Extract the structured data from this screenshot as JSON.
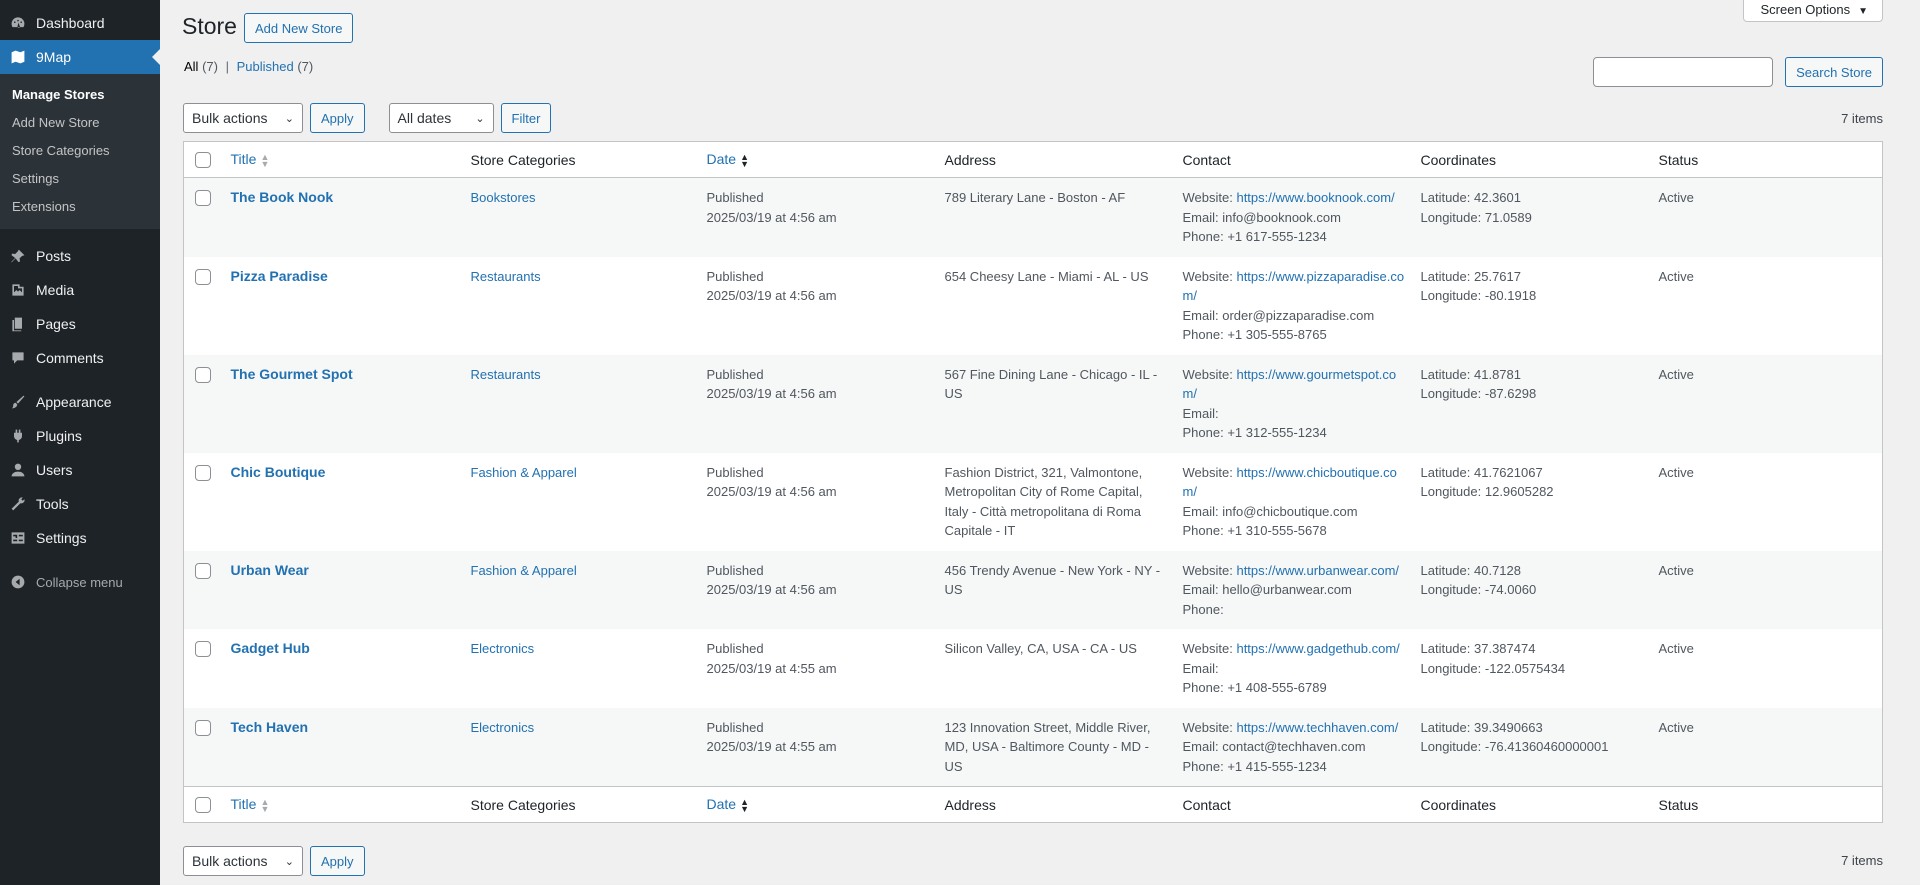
{
  "sidebar": {
    "dashboard": {
      "label": "Dashboard",
      "icon": "dashboard-icon"
    },
    "plugin_menu": {
      "label": "9Map",
      "icon": "map-icon"
    },
    "submenu": [
      "Manage Stores",
      "Add New Store",
      "Store Categories",
      "Settings",
      "Extensions"
    ],
    "items": [
      {
        "label": "Posts",
        "icon": "pin-icon"
      },
      {
        "label": "Media",
        "icon": "media-icon"
      },
      {
        "label": "Pages",
        "icon": "pages-icon"
      },
      {
        "label": "Comments",
        "icon": "comment-icon"
      },
      {
        "label": "Appearance",
        "icon": "brush-icon"
      },
      {
        "label": "Plugins",
        "icon": "plug-icon"
      },
      {
        "label": "Users",
        "icon": "user-icon"
      },
      {
        "label": "Tools",
        "icon": "wrench-icon"
      },
      {
        "label": "Settings",
        "icon": "settings-icon"
      }
    ],
    "collapse": "Collapse menu"
  },
  "header": {
    "title": "Store",
    "add_new": "Add New Store",
    "screen_options": "Screen Options"
  },
  "views": {
    "all_label": "All",
    "all_count": "(7)",
    "separator": "|",
    "published_label": "Published",
    "published_count": "(7)"
  },
  "search": {
    "button": "Search Store",
    "value": ""
  },
  "tablenav": {
    "bulk_actions": "Bulk actions",
    "apply": "Apply",
    "dates": "All dates",
    "filter": "Filter",
    "items_count": "7 items"
  },
  "columns": {
    "title": "Title",
    "categories": "Store Categories",
    "date": "Date",
    "address": "Address",
    "contact": "Contact",
    "coordinates": "Coordinates",
    "status": "Status"
  },
  "labels": {
    "website": "Website:",
    "email": "Email:",
    "phone": "Phone:",
    "latitude": "Latitude:",
    "longitude": "Longitude:"
  },
  "rows": [
    {
      "title": "The Book Nook",
      "category": "Bookstores",
      "date_status": "Published",
      "date": "2025/03/19 at 4:56 am",
      "address": "789 Literary Lane - Boston - AF",
      "website": "https://www.booknook.com/",
      "email": "info@booknook.com",
      "phone": "+1 617-555-1234",
      "lat": "42.3601",
      "lng": "71.0589",
      "status": "Active"
    },
    {
      "title": "Pizza Paradise",
      "category": "Restaurants",
      "date_status": "Published",
      "date": "2025/03/19 at 4:56 am",
      "address": "654 Cheesy Lane - Miami - AL - US",
      "website": "https://www.pizzaparadise.com/",
      "email": "order@pizzaparadise.com",
      "phone": "+1 305-555-8765",
      "lat": "25.7617",
      "lng": "-80.1918",
      "status": "Active"
    },
    {
      "title": "The Gourmet Spot",
      "category": "Restaurants",
      "date_status": "Published",
      "date": "2025/03/19 at 4:56 am",
      "address": "567 Fine Dining Lane - Chicago - IL - US",
      "website": "https://www.gourmetspot.com/",
      "email": "",
      "phone": "+1 312-555-1234",
      "lat": "41.8781",
      "lng": "-87.6298",
      "status": "Active"
    },
    {
      "title": "Chic Boutique",
      "category": "Fashion & Apparel",
      "date_status": "Published",
      "date": "2025/03/19 at 4:56 am",
      "address": "Fashion District, 321, Valmontone, Metropolitan City of Rome Capital, Italy - Città metropolitana di Roma Capitale - IT",
      "website": "https://www.chicboutique.com/",
      "email": "info@chicboutique.com",
      "phone": "+1 310-555-5678",
      "lat": "41.7621067",
      "lng": "12.9605282",
      "status": "Active"
    },
    {
      "title": "Urban Wear",
      "category": "Fashion & Apparel",
      "date_status": "Published",
      "date": "2025/03/19 at 4:56 am",
      "address": "456 Trendy Avenue - New York - NY - US",
      "website": "https://www.urbanwear.com/",
      "email": "hello@urbanwear.com",
      "phone": "",
      "lat": "40.7128",
      "lng": "-74.0060",
      "status": "Active"
    },
    {
      "title": "Gadget Hub",
      "category": "Electronics",
      "date_status": "Published",
      "date": "2025/03/19 at 4:55 am",
      "address": "Silicon Valley, CA, USA - CA - US",
      "website": "https://www.gadgethub.com/",
      "email": "",
      "phone": "+1 408-555-6789",
      "lat": "37.387474",
      "lng": "-122.0575434",
      "status": "Active"
    },
    {
      "title": "Tech Haven",
      "category": "Electronics",
      "date_status": "Published",
      "date": "2025/03/19 at 4:55 am",
      "address": "123 Innovation Street, Middle River, MD, USA - Baltimore County - MD - US",
      "website": "https://www.techhaven.com/",
      "email": "contact@techhaven.com",
      "phone": "+1 415-555-1234",
      "lat": "39.3490663",
      "lng": "-76.41360460000001",
      "status": "Active"
    }
  ]
}
